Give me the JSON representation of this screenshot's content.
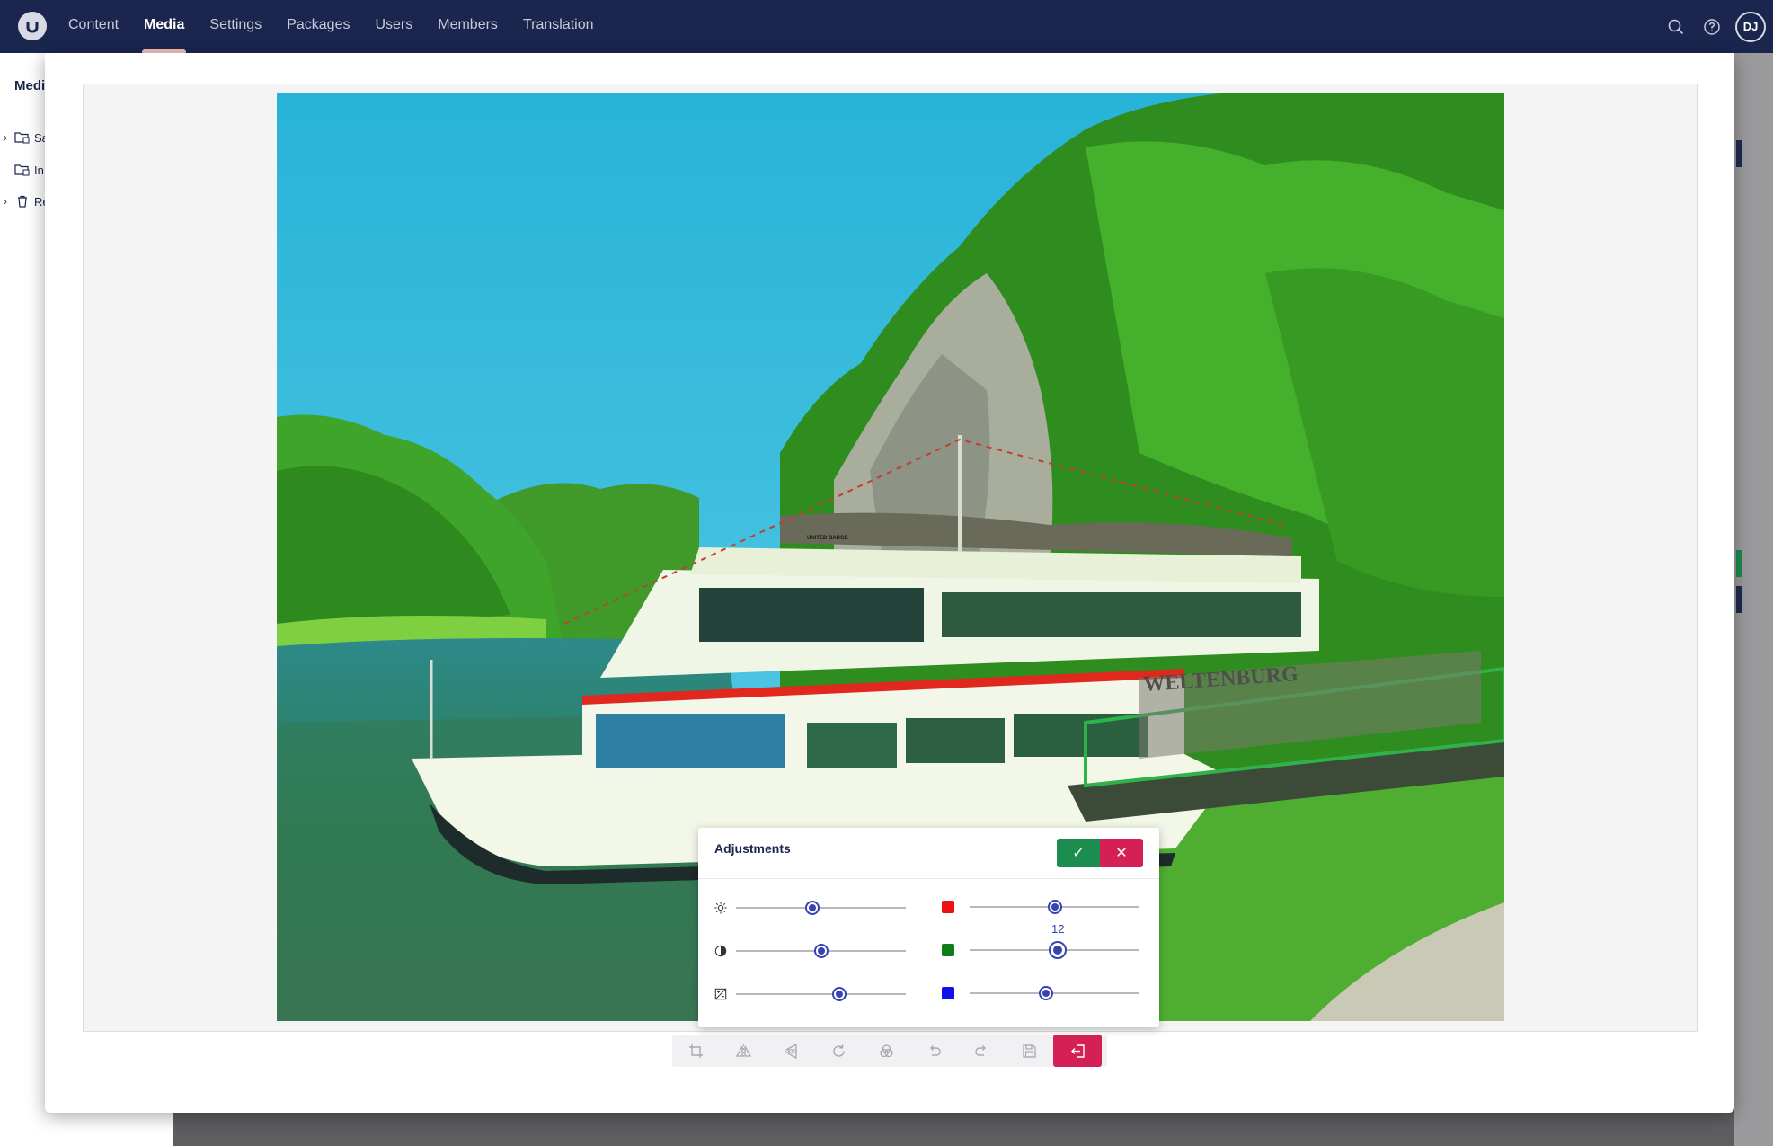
{
  "nav": {
    "items": [
      {
        "label": "Content",
        "active": false
      },
      {
        "label": "Media",
        "active": true
      },
      {
        "label": "Settings",
        "active": false
      },
      {
        "label": "Packages",
        "active": false
      },
      {
        "label": "Users",
        "active": false
      },
      {
        "label": "Members",
        "active": false
      },
      {
        "label": "Translation",
        "active": false
      }
    ],
    "logo_icon": "umbraco-logo-icon",
    "search_icon": "search-icon",
    "help_icon": "help-icon",
    "user_initials": "DJ"
  },
  "sidebar": {
    "title": "Medi",
    "items": [
      {
        "label": "Sa",
        "icon": "media-folder-icon",
        "expandable": true
      },
      {
        "label": "In",
        "icon": "media-folder-icon",
        "expandable": false
      },
      {
        "label": "Re",
        "icon": "trash-icon",
        "expandable": true
      }
    ]
  },
  "photo": {
    "boat_name": "WELTENBURG",
    "sign_text": "UNITED BARGE"
  },
  "adjustments": {
    "title": "Adjustments",
    "apply_icon": "check-icon",
    "cancel_icon": "close-icon",
    "left_sliders": [
      {
        "name": "brightness",
        "icon": "brightness-icon",
        "level": 0.45
      },
      {
        "name": "contrast",
        "icon": "contrast-icon",
        "level": 0.5
      },
      {
        "name": "exposure",
        "icon": "exposure-icon",
        "level": 0.61
      }
    ],
    "right_sliders": [
      {
        "name": "red",
        "color": "#ee1111",
        "level": 0.5
      },
      {
        "name": "green",
        "color": "#0f7d15",
        "level": 0.52,
        "value": "12",
        "active": true
      },
      {
        "name": "blue",
        "color": "#1111ee",
        "level": 0.45
      }
    ]
  },
  "toolbar": {
    "tools": [
      "crop-icon",
      "flip-horizontal-icon",
      "flip-vertical-icon",
      "rotate-icon",
      "adjustments-icon",
      "undo-icon",
      "redo-icon",
      "save-icon",
      "exit-icon"
    ]
  },
  "colors": {
    "topbar": "#1b264f",
    "accent_red": "#d42054",
    "accent_green": "#1c8c4f",
    "slider_blue": "#3544b1"
  }
}
